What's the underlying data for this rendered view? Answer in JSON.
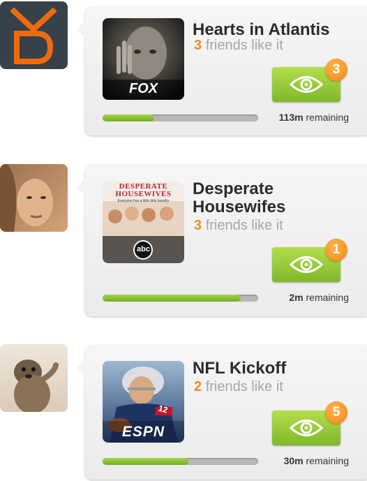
{
  "brand": {
    "logo_icon": "ok-logo-icon",
    "color": "#ef6a0f",
    "bg": "#364149"
  },
  "cards": [
    {
      "title": "Hearts in Atlantis",
      "friends_count": "3",
      "friends_text": "friends like it",
      "network": "FOX",
      "watch_icon": "eye-icon",
      "badge": "3",
      "progress": 0.33,
      "remaining_value": "113m",
      "remaining_text": "remaining"
    },
    {
      "title": "Desperate Housewifes",
      "poster_title": "DESPERATE HOUSEWIVES",
      "poster_tagline": "Everyone has a little dirty laundry",
      "friends_count": "3",
      "friends_text": "friends like it",
      "network": "abc",
      "watch_icon": "eye-icon",
      "badge": "1",
      "progress": 0.89,
      "remaining_value": "2m",
      "remaining_text": "remaining"
    },
    {
      "title": "NFL Kickoff",
      "friends_count": "2",
      "friends_text": "friends like it",
      "network": "ESPN",
      "jersey_number": "12",
      "watch_icon": "eye-icon",
      "badge": "5",
      "progress": 0.55,
      "remaining_value": "30m",
      "remaining_text": "remaining"
    }
  ],
  "colors": {
    "accent": "#f08a1e",
    "green": "#8fc43a"
  }
}
